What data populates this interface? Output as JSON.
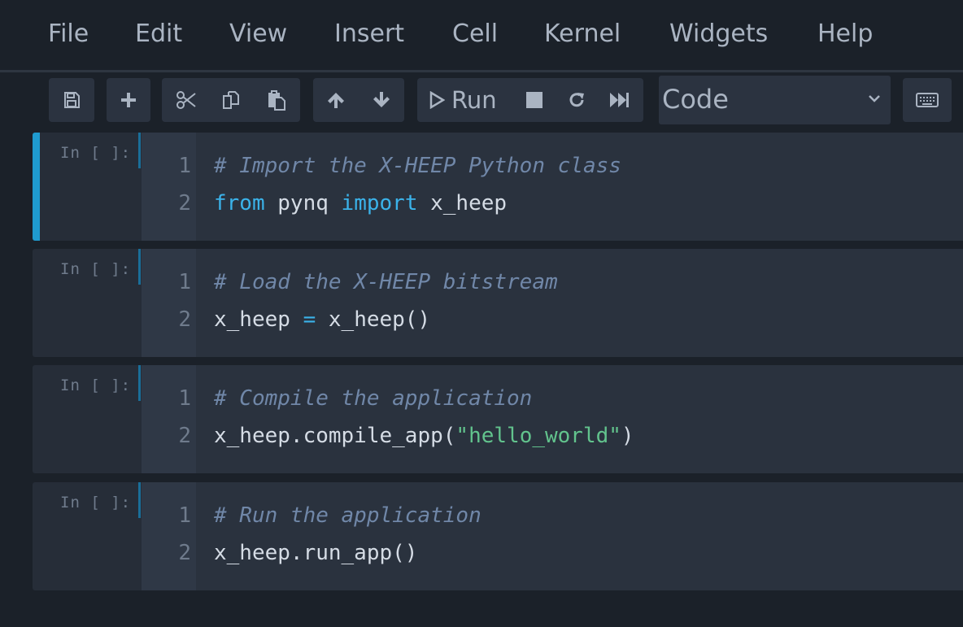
{
  "menu": [
    "File",
    "Edit",
    "View",
    "Insert",
    "Cell",
    "Kernel",
    "Widgets",
    "Help"
  ],
  "toolbar": {
    "run_label": "Run",
    "cell_type": "Code"
  },
  "cells": [
    {
      "prompt": "In [ ]:",
      "selected": true,
      "lines": [
        {
          "num": "1",
          "tokens": [
            {
              "t": "# Import the X-HEEP Python class",
              "c": "comment"
            }
          ]
        },
        {
          "num": "2",
          "tokens": [
            {
              "t": "from",
              "c": "kw"
            },
            {
              "t": " pynq ",
              "c": "name"
            },
            {
              "t": "import",
              "c": "kw"
            },
            {
              "t": " x_heep",
              "c": "name"
            }
          ]
        }
      ]
    },
    {
      "prompt": "In [ ]:",
      "selected": false,
      "lines": [
        {
          "num": "1",
          "tokens": [
            {
              "t": "# Load the X-HEEP bitstream",
              "c": "comment"
            }
          ]
        },
        {
          "num": "2",
          "tokens": [
            {
              "t": "x_heep ",
              "c": "name"
            },
            {
              "t": "=",
              "c": "op"
            },
            {
              "t": " x_heep()",
              "c": "name"
            }
          ]
        }
      ]
    },
    {
      "prompt": "In [ ]:",
      "selected": false,
      "lines": [
        {
          "num": "1",
          "tokens": [
            {
              "t": "# Compile the application",
              "c": "comment"
            }
          ]
        },
        {
          "num": "2",
          "tokens": [
            {
              "t": "x_heep.compile_app(",
              "c": "name"
            },
            {
              "t": "\"hello_world\"",
              "c": "str"
            },
            {
              "t": ")",
              "c": "name"
            }
          ]
        }
      ]
    },
    {
      "prompt": "In [ ]:",
      "selected": false,
      "lines": [
        {
          "num": "1",
          "tokens": [
            {
              "t": "# Run the application",
              "c": "comment"
            }
          ]
        },
        {
          "num": "2",
          "tokens": [
            {
              "t": "x_heep.run_app()",
              "c": "name"
            }
          ]
        }
      ]
    }
  ],
  "colors": {
    "accent": "#1f9bcf",
    "keyword": "#3bb3ea",
    "string": "#62c38d",
    "comment": "#7087a8",
    "text": "#d5dce5"
  }
}
